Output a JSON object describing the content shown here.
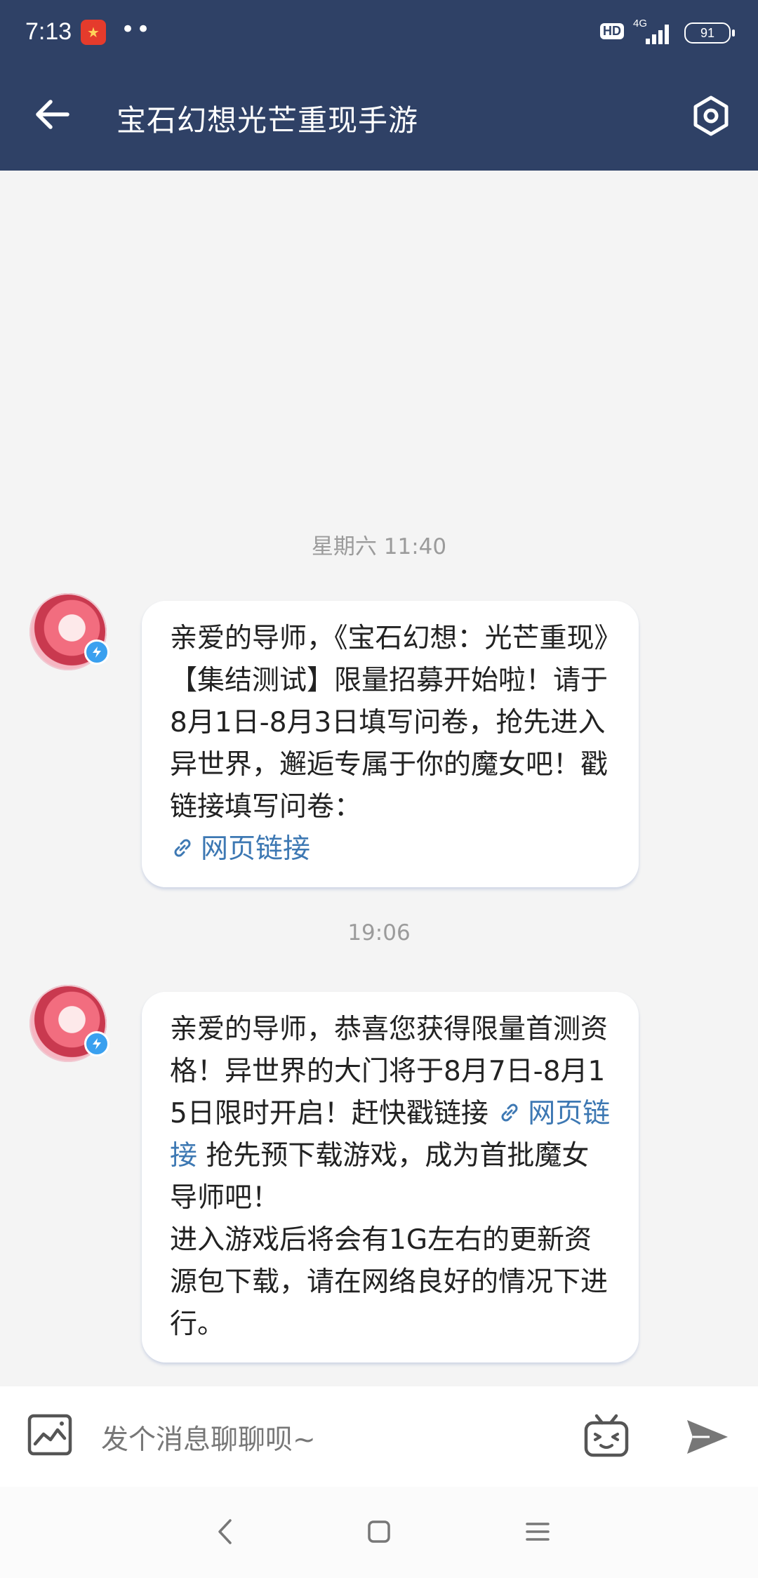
{
  "status_bar": {
    "time": "7:13",
    "dots": "••",
    "hd_label": "HD",
    "network_label": "4G",
    "battery": "91"
  },
  "header": {
    "title": "宝石幻想光芒重现手游"
  },
  "messages": [
    {
      "timestamp": "星期六 11:40",
      "text_parts": [
        "亲爱的导师，《宝石幻想：光芒重现》【集结测试】限量招募开始啦！请于8月1日-8月3日填写问卷，抢先进入异世界，邂逅专属于你的魔女吧！戳链接填写问卷："
      ],
      "link_label": "网页链接"
    },
    {
      "timestamp": "19:06",
      "text_before_link": "亲爱的导师，恭喜您获得限量首测资格！异世界的大门将于8月7日-8月15日限时开启！赶快戳链接 ",
      "link_label": "网页链接",
      "text_after_link": " 抢先预下载游戏，成为首批魔女导师吧！",
      "text_line2": "进入游戏后将会有1G左右的更新资源包下载，请在网络良好的情况下进行。"
    }
  ],
  "composer": {
    "placeholder": "发个消息聊聊呗~"
  },
  "colors": {
    "header_bg": "#2f4166",
    "link": "#3d78b3",
    "chat_bg": "#f4f4f4"
  },
  "icons": {
    "back": "arrow-left-icon",
    "settings": "hexagon-gear-icon",
    "image": "image-icon",
    "emoji": "bilibili-tv-icon",
    "send": "send-icon",
    "link": "link-icon"
  }
}
